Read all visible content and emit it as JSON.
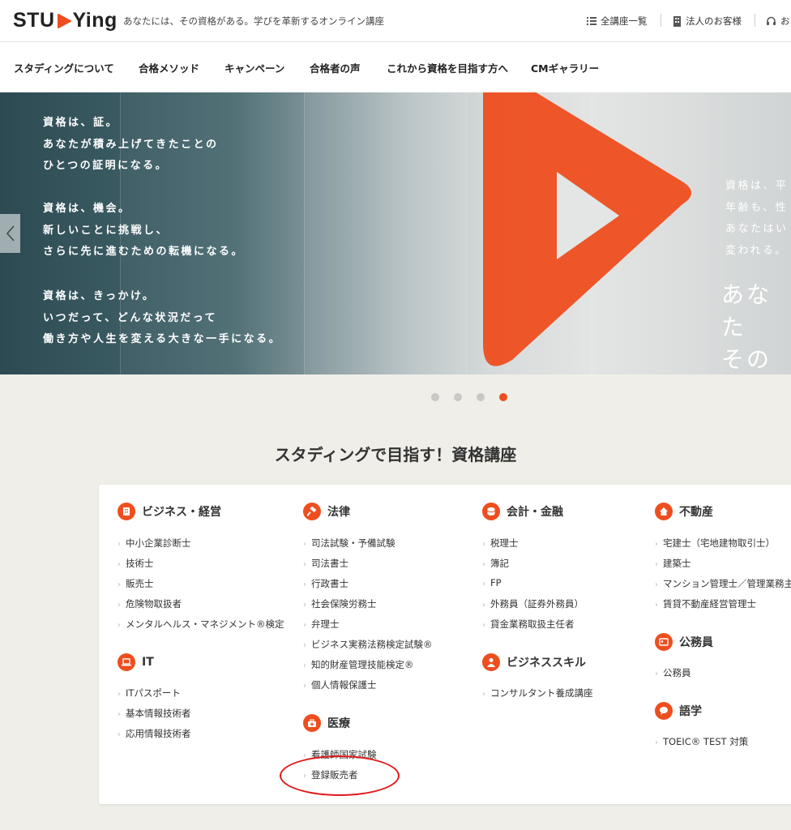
{
  "header": {
    "logo_text": "STUDYing",
    "tagline": "あなたには、その資格がある。学びを革新するオンライン講座",
    "util": [
      {
        "label": "全講座一覧",
        "icon": "list-icon"
      },
      {
        "label": "法人のお客様",
        "icon": "building-icon"
      },
      {
        "label": "お",
        "icon": "headset-icon"
      }
    ]
  },
  "nav": {
    "items": [
      "スタディングについて",
      "合格メソッド",
      "キャンペーン",
      "合格者の声",
      "これから資格を目指す方へ",
      "CMギャラリー"
    ]
  },
  "hero": {
    "paragraphs": [
      [
        "資格は、証。",
        "あなたが積み上げてきたことの",
        "ひとつの証明になる。"
      ],
      [
        "資格は、機会。",
        "新しいことに挑戦し、",
        "さらに先に進むための転機になる。"
      ],
      [
        "資格は、きっかけ。",
        "いつだって、どんな状況だって",
        "働き方や人生を変える大きな一手になる。"
      ]
    ],
    "right_lines": [
      "資格は、平",
      "年齢も、性",
      "あなたはい",
      "変われる。"
    ],
    "right_big": [
      "あなた",
      "その資"
    ],
    "accent": "#ee4e1f"
  },
  "carousel": {
    "count": 4,
    "active": 4
  },
  "courses": {
    "title": "スタディングで目指す！資格講座",
    "categories": {
      "business": {
        "title": "ビジネス・経営",
        "icon": "business-icon",
        "items": [
          "中小企業診断士",
          "技術士",
          "販売士",
          "危険物取扱者",
          "メンタルヘルス・マネジメント®検定"
        ]
      },
      "it": {
        "title": "IT",
        "icon": "laptop-icon",
        "items": [
          "ITパスポート",
          "基本情報技術者",
          "応用情報技術者"
        ]
      },
      "law": {
        "title": "法律",
        "icon": "gavel-icon",
        "items": [
          "司法試験・予備試験",
          "司法書士",
          "行政書士",
          "社会保険労務士",
          "弁理士",
          "ビジネス実務法務検定試験®",
          "知的財産管理技能検定®",
          "個人情報保護士"
        ]
      },
      "medical": {
        "title": "医療",
        "icon": "medical-bag-icon",
        "items": [
          "看護師国家試験",
          "登録販売者"
        ]
      },
      "accounting": {
        "title": "会計・金融",
        "icon": "coins-icon",
        "items": [
          "税理士",
          "簿記",
          "FP",
          "外務員（証券外務員）",
          "貸金業務取扱主任者"
        ]
      },
      "bizskill": {
        "title": "ビジネススキル",
        "icon": "person-icon",
        "items": [
          "コンサルタント養成講座"
        ]
      },
      "realestate": {
        "title": "不動産",
        "icon": "house-icon",
        "items": [
          "宅建士（宅地建物取引士）",
          "建築士",
          "マンション管理士／管理業務主",
          "賃貸不動産経営管理士"
        ]
      },
      "civil": {
        "title": "公務員",
        "icon": "id-card-icon",
        "items": [
          "公務員"
        ]
      },
      "language": {
        "title": "語学",
        "icon": "speech-bubble-icon",
        "items": [
          "TOEIC® TEST 対策"
        ]
      }
    }
  }
}
